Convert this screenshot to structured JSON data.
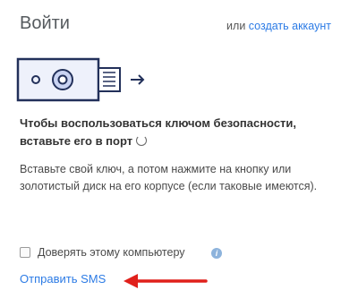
{
  "header": {
    "title": "Войти",
    "or_text": "или",
    "create_account_link": "создать аккаунт"
  },
  "illustration": {
    "key_icon": "security-key-icon",
    "arrow_icon": "arrow-right-icon"
  },
  "message": {
    "bold": "Чтобы воспользоваться ключом безопасности, вставьте его в порт",
    "description": "Вставьте свой ключ, а потом нажмите на кнопку или золотистый диск на его корпусе (если таковые имеются)."
  },
  "trust": {
    "label": "Доверять этому компьютеру",
    "checked": false,
    "info_icon": "info-icon"
  },
  "sms": {
    "label": "Отправить SMS"
  },
  "colors": {
    "link": "#2c7be5",
    "annotation_arrow": "#e0201b"
  }
}
